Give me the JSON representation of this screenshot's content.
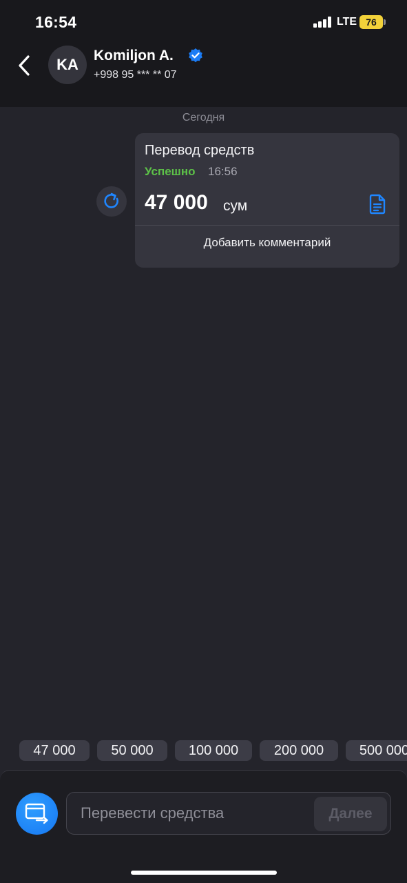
{
  "status_bar": {
    "time": "16:54",
    "network": "LTE",
    "battery": "76"
  },
  "header": {
    "avatar_initials": "KA",
    "name": "Komiljon A.",
    "phone": "+998 95 *** ** 07"
  },
  "chat": {
    "date_label": "Сегодня",
    "message": {
      "title": "Перевод средств",
      "status": "Успешно",
      "time": "16:56",
      "amount": "47 000",
      "currency": "сум",
      "comment_action": "Добавить комментарий"
    }
  },
  "quick_amounts": [
    "47 000",
    "50 000",
    "100 000",
    "200 000",
    "500 000"
  ],
  "composer": {
    "placeholder": "Перевести средства",
    "next_label": "Далее"
  },
  "colors": {
    "background": "#24242b",
    "header_bg": "#18181c",
    "accent_blue": "#1677f2",
    "success_green": "#5dc248",
    "battery_yellow": "#f3d23a"
  }
}
